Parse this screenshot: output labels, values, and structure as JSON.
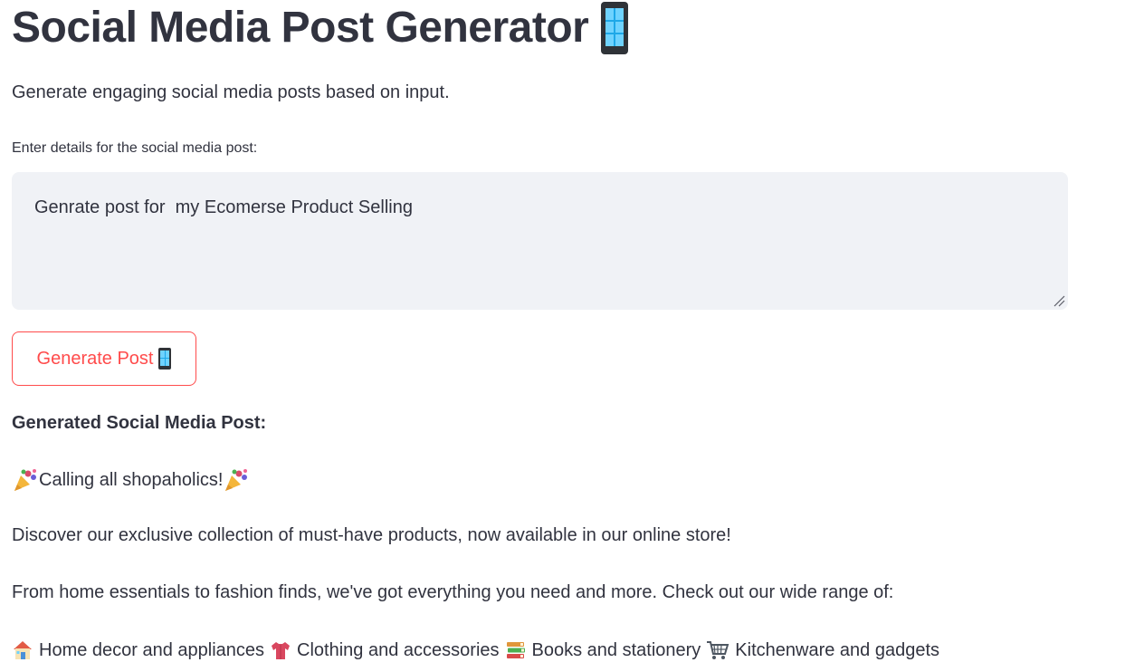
{
  "page": {
    "title": "Social Media Post Generator",
    "title_icon": "mobile-phone-icon",
    "subtitle": "Generate engaging social media posts based on input."
  },
  "form": {
    "label": "Enter details for the social media post:",
    "input_value": "Genrate post for  my Ecomerse Product Selling",
    "button_label": "Generate Post",
    "button_icon": "mobile-phone-icon"
  },
  "result": {
    "heading": "Generated Social Media Post:",
    "greeting": "Calling all shopaholics!",
    "greeting_icon": "party-popper-icon",
    "paragraph1": "Discover our exclusive collection of must-have products, now available in our online store!",
    "paragraph2": "From home essentials to fashion finds, we've got everything you need and more. Check out our wide range of:",
    "categories": [
      {
        "icon": "house-icon",
        "label": "Home decor and appliances"
      },
      {
        "icon": "shirt-icon",
        "label": "Clothing and accessories"
      },
      {
        "icon": "books-icon",
        "label": "Books and stationery"
      },
      {
        "icon": "shopping-cart-icon",
        "label": "Kitchenware and gadgets"
      }
    ]
  },
  "colors": {
    "text": "#31333f",
    "accent": "#ff4b4b",
    "input_bg": "#f0f2f6"
  }
}
